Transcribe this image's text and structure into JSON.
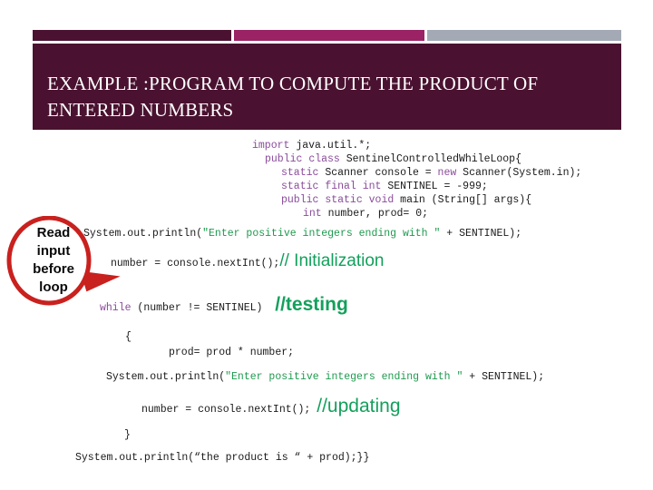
{
  "slide": {
    "title": "EXAMPLE :PROGRAM TO COMPUTE THE PRODUCT OF\nENTERED NUMBERS",
    "banner_color": "#4A1230",
    "accent_color": "#9B2265",
    "gray_color": "#A3AAB5"
  },
  "decor_bars": [
    {
      "name": "bar-dark",
      "color": "#4A1230"
    },
    {
      "name": "bar-magenta",
      "color": "#9B2265"
    },
    {
      "name": "bar-gray",
      "color": "#A3AAB5"
    }
  ],
  "code": {
    "line1_kw": "import",
    "line1_rest": " java.util.*;",
    "line2_kw": "public",
    "line2_kw2": "class",
    "line2_rest": " SentinelControlledWhileLoop{",
    "line3_kw": "static",
    "line3_mid": " Scanner console = ",
    "line3_kw2": "new",
    "line3_rest": " Scanner(System.in);",
    "line4_kw": "static",
    "line4_kw2": "final",
    "line4_kw3": "int",
    "line4_rest": " SENTINEL = -999;",
    "line5_kw": "public",
    "line5_kw2": "static",
    "line5_kw3": "void",
    "line5_rest": " main (String[] args){",
    "line6_kw": "int",
    "line6_rest": " number, prod= 0;",
    "line7_pre": "System.out.println(",
    "line7_str": "\"Enter positive integers ending with \"",
    "line7_post": " + SENTINEL);",
    "line8_code": "number = console.nextInt();",
    "line8_comment": "// Initialization",
    "line9_kw": "while",
    "line9_rest": " (number != SENTINEL)",
    "line9_comment": "//testing",
    "line10_brace": "{",
    "line11_code": "prod= prod * number;",
    "line12_pre": "System.out.println(",
    "line12_str": "\"Enter positive integers ending with \"",
    "line12_post": " + SENTINEL);",
    "line13_code": "number = console.nextInt();",
    "line13_comment": "//updating",
    "line14_brace": "}",
    "line15_code": "System.out.println(“the product is “ + prod);}}"
  },
  "callout": {
    "label": "Read\ninput\nbefore\nloop",
    "color": "#C9211E"
  }
}
